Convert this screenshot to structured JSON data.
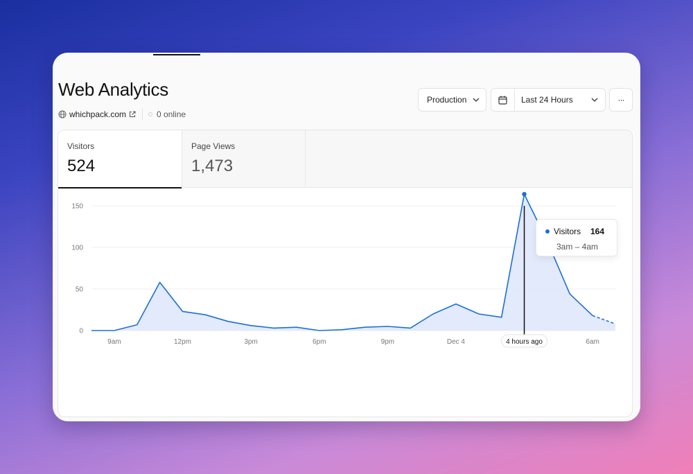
{
  "header": {
    "title": "Web Analytics",
    "site": "whichpack.com",
    "online": "0 online"
  },
  "controls": {
    "environment": "Production",
    "date_range": "Last 24 Hours",
    "more": "···"
  },
  "tabs": [
    {
      "label": "Visitors",
      "value": "524"
    },
    {
      "label": "Page Views",
      "value": "1,473"
    }
  ],
  "tooltip": {
    "series": "Visitors",
    "value": "164",
    "range": "3am – 4am"
  },
  "colors": {
    "line": "#1a6fd8",
    "area": "#dfe8fb",
    "grid": "#ececec",
    "cursor": "#111111"
  },
  "chart_data": {
    "type": "area",
    "series": [
      {
        "name": "Visitors",
        "values": [
          0,
          0,
          7,
          58,
          23,
          19,
          11,
          6,
          3,
          4,
          0,
          1,
          4,
          5,
          3,
          20,
          32,
          20,
          16,
          164,
          108,
          44,
          18,
          8
        ]
      }
    ],
    "incomplete_last_segment": true,
    "ylim": [
      0,
      180
    ],
    "yticks": [
      0,
      50,
      100,
      150
    ],
    "xticks": [
      {
        "label": "9am",
        "index": 1
      },
      {
        "label": "12pm",
        "index": 4
      },
      {
        "label": "3pm",
        "index": 7
      },
      {
        "label": "6pm",
        "index": 10
      },
      {
        "label": "9pm",
        "index": 13
      },
      {
        "label": "Dec 4",
        "index": 16
      },
      {
        "label": "4 hours ago",
        "index": 19,
        "highlight": true
      },
      {
        "label": "6am",
        "index": 22
      }
    ],
    "hover_index": 19,
    "grid": true
  }
}
